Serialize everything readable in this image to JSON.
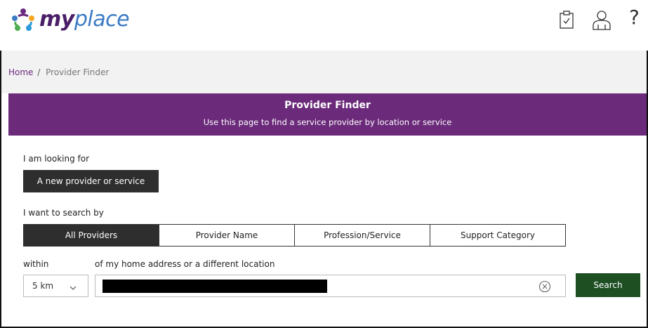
{
  "brand": {
    "my": "my",
    "place": "place"
  },
  "header": {
    "icons": [
      "clipboard-check-icon",
      "user-icon",
      "help-icon"
    ],
    "help_glyph": "?"
  },
  "breadcrumb": {
    "home": "Home",
    "separator": "/",
    "current": "Provider Finder"
  },
  "banner": {
    "title": "Provider Finder",
    "subtitle": "Use this page to find a service provider by location or service"
  },
  "form": {
    "looking_for_label": "I am looking for",
    "looking_for_value": "A new provider or service",
    "search_by_label": "I want to search by",
    "tabs": [
      {
        "label": "All Providers",
        "active": true
      },
      {
        "label": "Provider Name",
        "active": false
      },
      {
        "label": "Profession/Service",
        "active": false
      },
      {
        "label": "Support Category",
        "active": false
      }
    ],
    "within_label": "within",
    "location_label": "of my home address or a different location",
    "distance_value": "5 km",
    "search_label": "Search"
  },
  "colors": {
    "banner": "#6b2a7a",
    "search_button": "#1e4f23",
    "active_tab": "#2e2e2e",
    "link": "#6b2a7f"
  }
}
